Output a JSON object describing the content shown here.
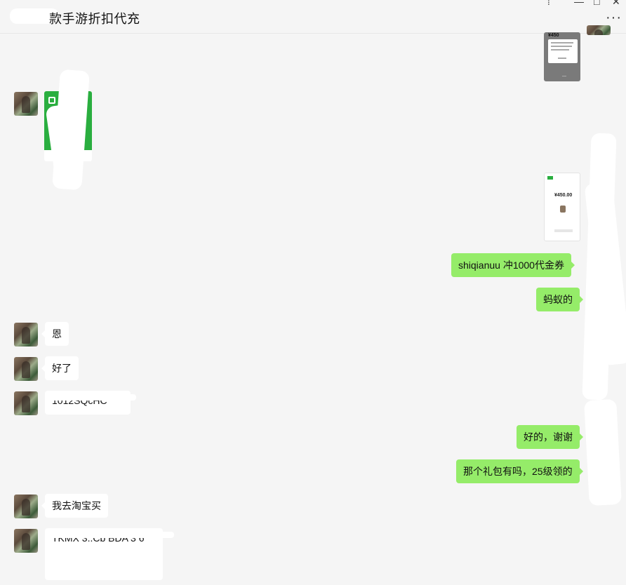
{
  "window": {
    "title": "款手游折扣代充",
    "controls": [
      "pin-icon",
      "minimize-icon",
      "maximize-icon",
      "close-icon"
    ],
    "more_label": "···"
  },
  "messages": {
    "m1_amount": "¥450",
    "m3_amount": "¥450.00",
    "m4_text": "shiqianuu  冲1000代金券",
    "m5_text": "蚂蚁的",
    "m6_text": "恩",
    "m7_text": "好了",
    "m8_text": "1012SQcHC",
    "m9_text": "好的，谢谢",
    "m10_text": "那个礼包有吗，25级领的",
    "m11_text": "我去淘宝买",
    "m12_text": "TKMX 3..Cb  BDA  3  6"
  },
  "colors": {
    "background": "#f5f5f5",
    "bubble_in": "#ffffff",
    "bubble_out": "#95ec69",
    "transfer_green": "#2aae3f"
  }
}
